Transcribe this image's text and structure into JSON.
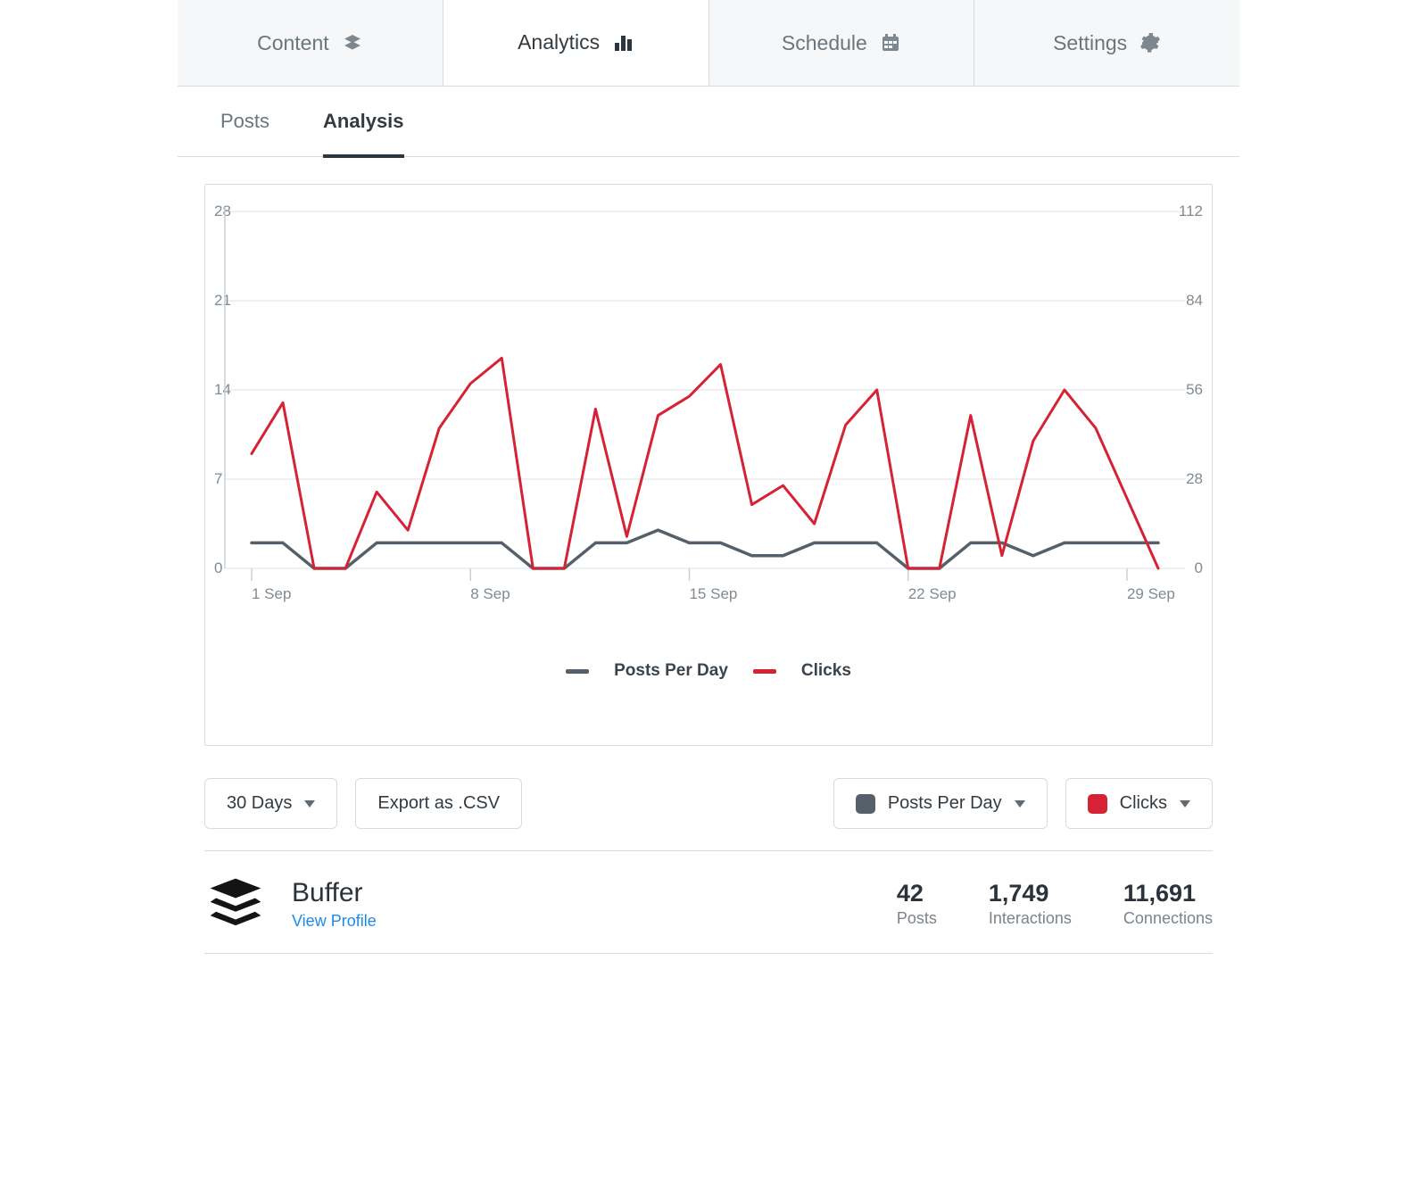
{
  "tabs": {
    "content": "Content",
    "analytics": "Analytics",
    "schedule": "Schedule",
    "settings": "Settings"
  },
  "subtabs": {
    "posts": "Posts",
    "analysis": "Analysis"
  },
  "chart_legend": {
    "posts": "Posts Per Day",
    "clicks": "Clicks"
  },
  "controls": {
    "range": "30 Days",
    "export": "Export as .CSV",
    "leftMetric": "Posts Per Day",
    "rightMetric": "Clicks"
  },
  "profile": {
    "name": "Buffer",
    "link_label": "View Profile",
    "stats": [
      {
        "value": "42",
        "label": "Posts"
      },
      {
        "value": "1,749",
        "label": "Interactions"
      },
      {
        "value": "11,691",
        "label": "Connections"
      }
    ]
  },
  "chart_data": {
    "type": "line",
    "x": [
      "1 Sep",
      "2 Sep",
      "3 Sep",
      "4 Sep",
      "5 Sep",
      "6 Sep",
      "7 Sep",
      "8 Sep",
      "9 Sep",
      "10 Sep",
      "11 Sep",
      "12 Sep",
      "13 Sep",
      "14 Sep",
      "15 Sep",
      "16 Sep",
      "17 Sep",
      "18 Sep",
      "19 Sep",
      "20 Sep",
      "21 Sep",
      "22 Sep",
      "23 Sep",
      "24 Sep",
      "25 Sep",
      "26 Sep",
      "27 Sep",
      "28 Sep",
      "29 Sep",
      "30 Sep"
    ],
    "x_ticks": [
      "1 Sep",
      "8 Sep",
      "15 Sep",
      "22 Sep",
      "29 Sep"
    ],
    "series": [
      {
        "name": "Posts Per Day",
        "axis": "left",
        "color": "#55606a",
        "values": [
          2,
          2,
          0,
          0,
          2,
          2,
          2,
          2,
          2,
          0,
          0,
          2,
          2,
          3,
          2,
          2,
          1,
          1,
          2,
          2,
          2,
          0,
          0,
          2,
          2,
          1,
          2,
          2,
          2,
          2
        ]
      },
      {
        "name": "Clicks",
        "axis": "right",
        "color": "#d52234",
        "values": [
          36,
          52,
          0,
          0,
          24,
          12,
          44,
          58,
          66,
          0,
          0,
          50,
          10,
          48,
          54,
          64,
          20,
          26,
          14,
          45,
          56,
          0,
          0,
          48,
          4,
          40,
          56,
          44,
          22,
          0
        ]
      }
    ],
    "axes": {
      "left": {
        "min": 0,
        "max": 28,
        "ticks": [
          0,
          7,
          14,
          21,
          28
        ],
        "label": "Posts Per Day"
      },
      "right": {
        "min": 0,
        "max": 112,
        "ticks": [
          0,
          28,
          56,
          84,
          112
        ],
        "label": "Clicks"
      }
    },
    "grid": true,
    "title": ""
  }
}
